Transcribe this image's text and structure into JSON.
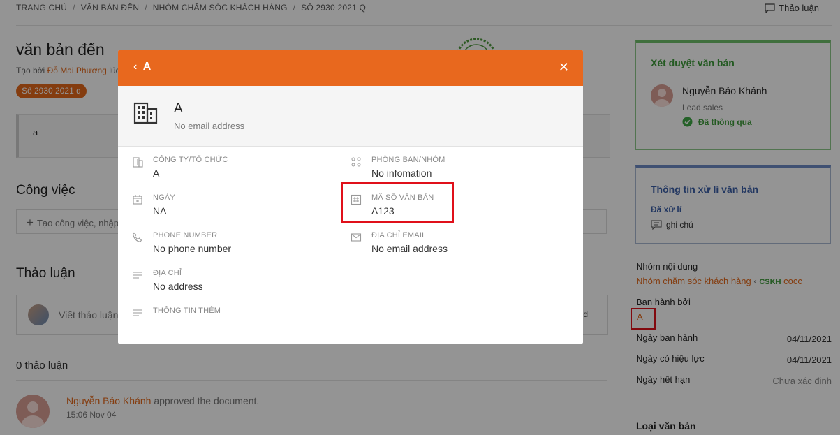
{
  "breadcrumb": [
    "TRANG CHỦ",
    "VĂN BẢN ĐẾN",
    "NHÓM CHĂM SÓC KHÁCH HÀNG",
    "SỐ 2930 2021 Q"
  ],
  "top_discuss_label": "Thảo luận",
  "page": {
    "title": "văn bản đến",
    "byline_prefix": "Tạo bởi",
    "byline_author": "Đỗ Mai Phương",
    "byline_suffix": "lúc",
    "number_pill": "Số 2930 2021 q",
    "content_text": "a"
  },
  "tasks": {
    "heading": "Công việc",
    "placeholder": "Tạo công việc, nhập"
  },
  "discussion": {
    "heading": "Thảo luận",
    "placeholder": "Viết thảo luận",
    "right_fragment": "d",
    "count_label": "0 thảo luận",
    "activity": {
      "user": "Nguyễn Bảo Khánh",
      "action": "approved the document.",
      "time": "15:06 Nov 04"
    }
  },
  "review": {
    "title": "Xét duyệt văn bản",
    "name": "Nguyễn Bảo Khánh",
    "role": "Lead sales",
    "status": "Đã thông qua"
  },
  "processing": {
    "title": "Thông tin xử lí văn bản",
    "status": "Đã xử lí",
    "note": "ghi chú"
  },
  "meta": {
    "group_label": "Nhóm nội dung",
    "group_value": "Nhóm chăm sóc khách hàng",
    "group_sep": "‹",
    "group_tag": "CSKH",
    "group_extra": "cocc",
    "issued_by_label": "Ban hành bởi",
    "issued_by_value": "A",
    "issue_date_label": "Ngày ban hành",
    "issue_date_value": "04/11/2021",
    "effective_label": "Ngày có hiệu lực",
    "effective_value": "04/11/2021",
    "expire_label": "Ngày hết hạn",
    "expire_value": "Chưa xác định",
    "doc_type_label": "Loại văn bản"
  },
  "modal": {
    "header_title": "A",
    "entity_name": "A",
    "entity_email": "No email address",
    "fields": {
      "company_label": "CÔNG TY/TỔ CHỨC",
      "company_value": "A",
      "dept_label": "PHÒNG BAN/NHÓM",
      "dept_value": "No infomation",
      "date_label": "NGÀY",
      "date_value": "NA",
      "code_label": "MÃ SỐ VĂN BẢN",
      "code_value": "A123",
      "phone_label": "PHONE NUMBER",
      "phone_value": "No phone number",
      "email_label": "ĐỊA CHỈ EMAIL",
      "email_value": "No email address",
      "address_label": "ĐỊA CHỈ",
      "address_value": "No address",
      "more_label": "THÔNG TIN THÊM"
    }
  },
  "colors": {
    "accent": "#e8681e",
    "green": "#3f9b3b",
    "blue": "#3b5fa8",
    "highlight": "#e0101a"
  }
}
